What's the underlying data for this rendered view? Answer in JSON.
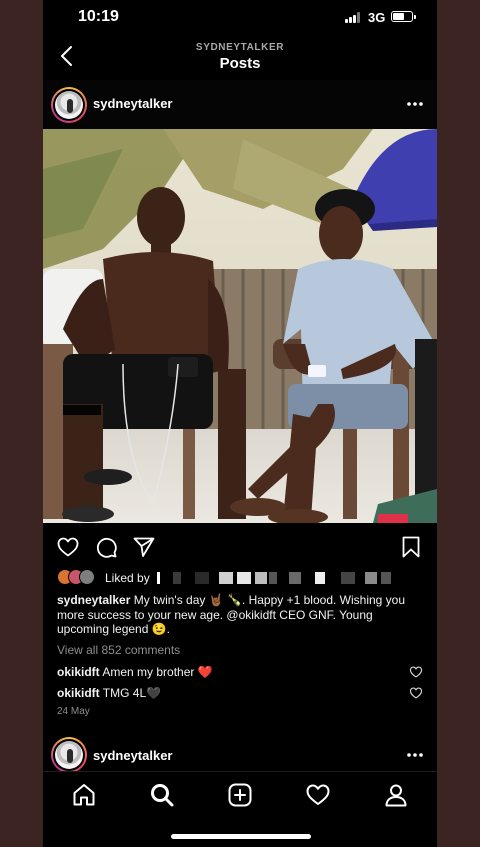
{
  "status_bar": {
    "time": "10:19",
    "network": "3G"
  },
  "header": {
    "subtitle": "SYDNEYTALKER",
    "title": "Posts"
  },
  "post": {
    "username": "sydneytalker",
    "liked_by_label": "Liked by",
    "caption_username": "sydneytalker",
    "caption_text": "My twin's day 🤘🏾 🍾. Happy +1 blood. Wishing you more success to your new age. @okikidft CEO GNF. Young upcoming legend 😉.",
    "view_all_comments": "View all 852 comments",
    "comments": [
      {
        "username": "okikidft",
        "text": "Amen my brother ❤️"
      },
      {
        "username": "okikidft",
        "text": "TMG 4L🖤"
      }
    ],
    "date": "24 May"
  },
  "next_post": {
    "username": "sydneytalker"
  },
  "icons": {
    "back": "chevron-left-icon",
    "more": "more-horizontal-icon",
    "like": "heart-icon",
    "comment": "comment-icon",
    "share": "paper-plane-icon",
    "save": "bookmark-icon",
    "home": "home-icon",
    "search": "search-icon",
    "add": "add-post-icon",
    "activity": "heart-icon",
    "profile": "profile-icon"
  },
  "colors": {
    "background": "#000000",
    "text": "#f2f2f2",
    "muted": "#8e8e8e",
    "heart_red": "#ed2a3e"
  }
}
